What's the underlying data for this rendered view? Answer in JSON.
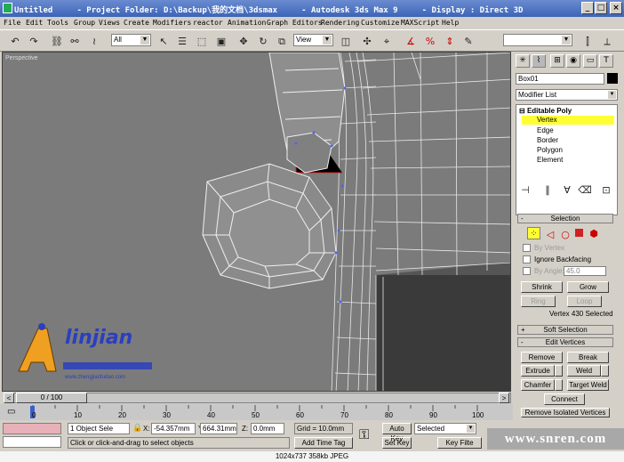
{
  "title_bar": {
    "text": "Untitled     - Project Folder: D:\\Backup\\我的文档\\3dsmax     - Autodesk 3ds Max 9     - Display : Direct 3D",
    "minimize": "_",
    "maximize": "□",
    "close": "×"
  },
  "menu": [
    "File",
    "Edit",
    "Tools",
    "Group",
    "Views",
    "Create",
    "Modifiers",
    "reactor",
    "Animation",
    "Graph Editors",
    "Rendering",
    "Customize",
    "MAXScript",
    "Help"
  ],
  "toolbar": {
    "filter_value": "All",
    "refcoord_value": "View"
  },
  "viewport": {
    "label": "Perspective"
  },
  "logo": {
    "name": "linjian",
    "url": "www.zhengjianfudao.com"
  },
  "command_panel": {
    "object_name": "Box01",
    "modifier_list": "Modifier List",
    "stack": {
      "root": "Editable Poly",
      "items": [
        "Vertex",
        "Edge",
        "Border",
        "Polygon",
        "Element"
      ],
      "selected": "Vertex"
    },
    "selection": {
      "title": "Selection",
      "by_vertex": "By Vertex",
      "ignore_backfacing": "Ignore Backfacing",
      "by_angle": "By Angle:",
      "angle_value": "45.0",
      "shrink": "Shrink",
      "grow": "Grow",
      "ring": "Ring",
      "loop": "Loop",
      "status": "Vertex 430 Selected"
    },
    "soft_selection": {
      "title": "Soft Selection"
    },
    "edit_vertices": {
      "title": "Edit Vertices",
      "remove": "Remove",
      "break": "Break",
      "extrude": "Extrude",
      "weld": "Weld",
      "chamfer": "Chamfer",
      "target_weld": "Target Weld",
      "connect": "Connect",
      "remove_isolated": "Remove Isolated Vertices"
    }
  },
  "timeline": {
    "frame": "0 / 100",
    "ticks": [
      "0",
      "10",
      "20",
      "30",
      "40",
      "50",
      "60",
      "70",
      "80",
      "90",
      "100"
    ]
  },
  "status": {
    "selected_count": "1 Object Sele",
    "x_label": "X:",
    "x_value": "-54.357mm",
    "y_label": "Y:",
    "y_value": "664.31mm",
    "z_label": "Z:",
    "z_value": "0.0mm",
    "grid": "Grid = 10.0mm",
    "add_time_tag": "Add Time Tag",
    "prompt": "Click or click-and-drag to select objects",
    "auto_key": "Auto Key",
    "set_key": "Set Key",
    "key_mode": "Selected",
    "key_filters": "Key Filte"
  },
  "watermark": "www.snren.com",
  "footer": "1024x737  358kb  JPEG",
  "colors": {
    "selection_highlight": "#ffff33",
    "viewport_bg": "#7b7b7b",
    "titlebar": "#3c64b8",
    "logo_orange": "#f0a020",
    "logo_blue": "#2a3fc0"
  }
}
